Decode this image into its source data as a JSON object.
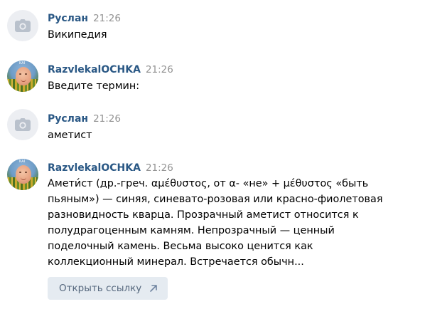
{
  "messages": [
    {
      "author": "Руслан",
      "time": "21:26",
      "avatar_icon": "camera-icon",
      "lines": [
        "Википедия"
      ]
    },
    {
      "author": "RazvlekalOCHKA",
      "time": "21:26",
      "avatar_badge": "KAI",
      "lines": [
        "Введите термин:"
      ]
    },
    {
      "author": "Руслан",
      "time": "21:26",
      "avatar_icon": "camera-icon",
      "lines": [
        "аметист"
      ]
    },
    {
      "author": "RazvlekalOCHKA",
      "time": "21:26",
      "avatar_badge": "KAI",
      "lines": [
        "Амети́ст (др.-греч. αμέθυστος, от α- «не» + μέθυστος «быть",
        "пьяным») — синяя, синевато-розовая или красно-фиолетовая",
        "разновидность кварца. Прозрачный аметист относится к",
        "полудрагоценным камням. Непрозрачный — ценный",
        "поделочный камень. Весьма высоко ценится как",
        "коллекционный минерал. Встречается обычн..."
      ]
    }
  ],
  "open_link": {
    "label": "Открыть ссылку",
    "icon": "arrow-up-right-icon"
  },
  "colors": {
    "author": "#2a5885",
    "time": "#939393",
    "button_bg": "#e5ebf1",
    "button_text": "#55677d",
    "camera_avatar_bg": "#eceef2"
  }
}
